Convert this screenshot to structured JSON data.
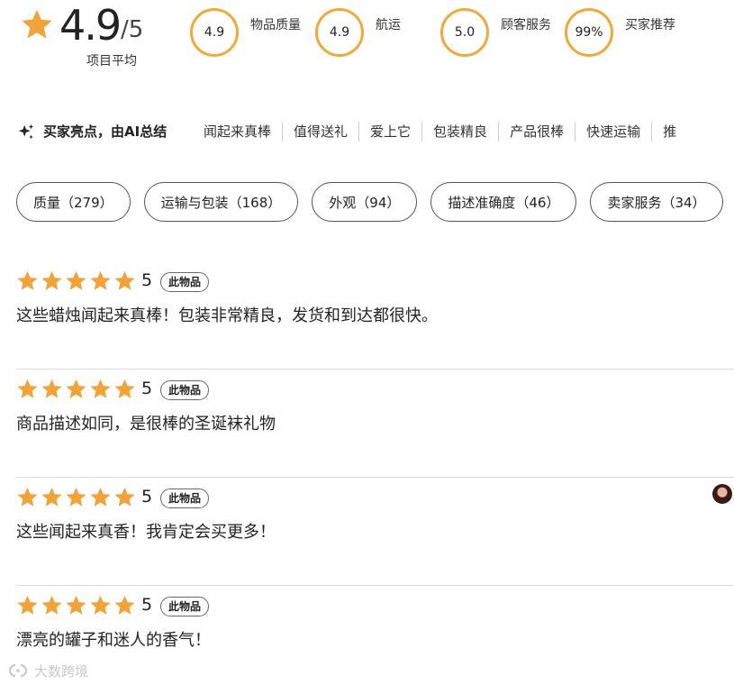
{
  "rating_summary": {
    "score": "4.9",
    "out_of": "/5",
    "caption": "项目平均",
    "metrics": [
      {
        "value": "4.9",
        "label": "物品质量"
      },
      {
        "value": "4.9",
        "label": "航运"
      },
      {
        "value": "5.0",
        "label": "顾客服务"
      },
      {
        "value": "99%",
        "label": "买家推荐"
      }
    ]
  },
  "highlights": {
    "icon": "sparkle-icon",
    "title": "买家亮点，由AI总结",
    "items": [
      "闻起来真棒",
      "值得送礼",
      "爱上它",
      "包装精良",
      "产品很棒",
      "快速运输",
      "推"
    ]
  },
  "filter_chips": [
    "质量（279）",
    "运输与包装（168）",
    "外观（94）",
    "描述准确度（46）",
    "卖家服务（34）"
  ],
  "reviews": [
    {
      "stars": 5,
      "score": "5",
      "badge": "此物品",
      "text": "这些蜡烛闻起来真棒！包装非常精良，发货和到达都很快。",
      "has_avatar": false
    },
    {
      "stars": 5,
      "score": "5",
      "badge": "此物品",
      "text": "商品描述如同，是很棒的圣诞袜礼物",
      "has_avatar": false
    },
    {
      "stars": 5,
      "score": "5",
      "badge": "此物品",
      "text": "这些闻起来真香！我肯定会买更多！",
      "has_avatar": true
    },
    {
      "stars": 5,
      "score": "5",
      "badge": "此物品",
      "text": "漂亮的罐子和迷人的香气！",
      "has_avatar": false
    }
  ],
  "watermark": {
    "text": "大数跨境"
  },
  "colors": {
    "accent": "#f0a93b",
    "star": "#f1a33a",
    "text": "#222222",
    "divider": "#dcdcdc"
  }
}
